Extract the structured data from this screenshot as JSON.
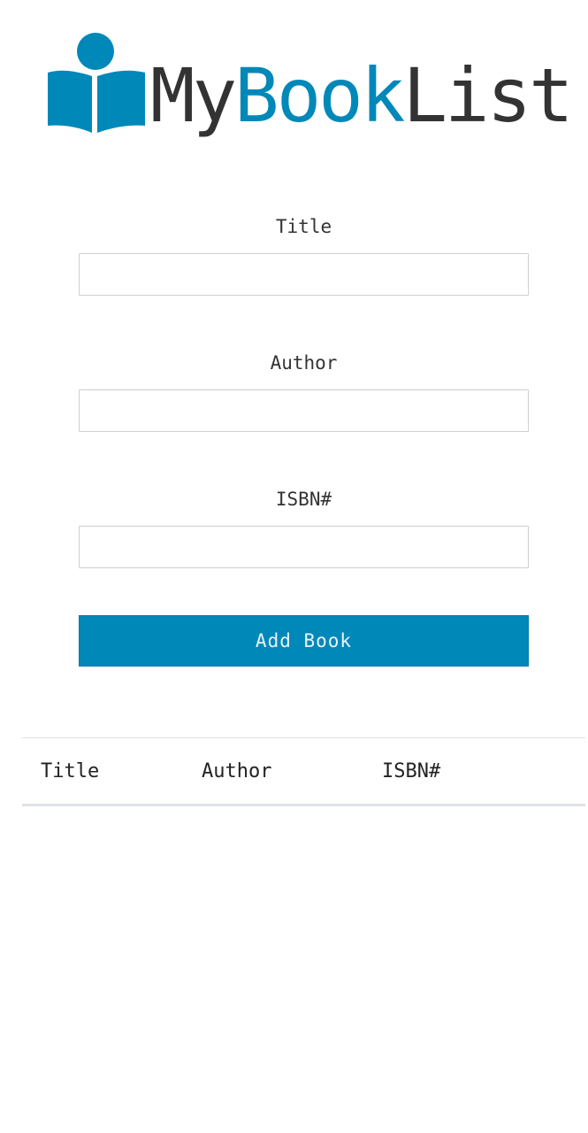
{
  "logo": {
    "text_my": "My",
    "text_book": "Book",
    "text_list": "List",
    "icon": "open-book-reader-icon",
    "colors": {
      "dark": "#333333",
      "accent": "#0088b9"
    }
  },
  "form": {
    "title_label": "Title",
    "title_value": "",
    "author_label": "Author",
    "author_value": "",
    "isbn_label": "ISBN#",
    "isbn_value": "",
    "submit_label": "Add Book"
  },
  "table": {
    "headers": [
      "Title",
      "Author",
      "ISBN#"
    ],
    "rows": []
  },
  "colors": {
    "button_bg": "#0088b9",
    "input_border": "#cfcfcf",
    "table_border": "#dee2e6"
  }
}
